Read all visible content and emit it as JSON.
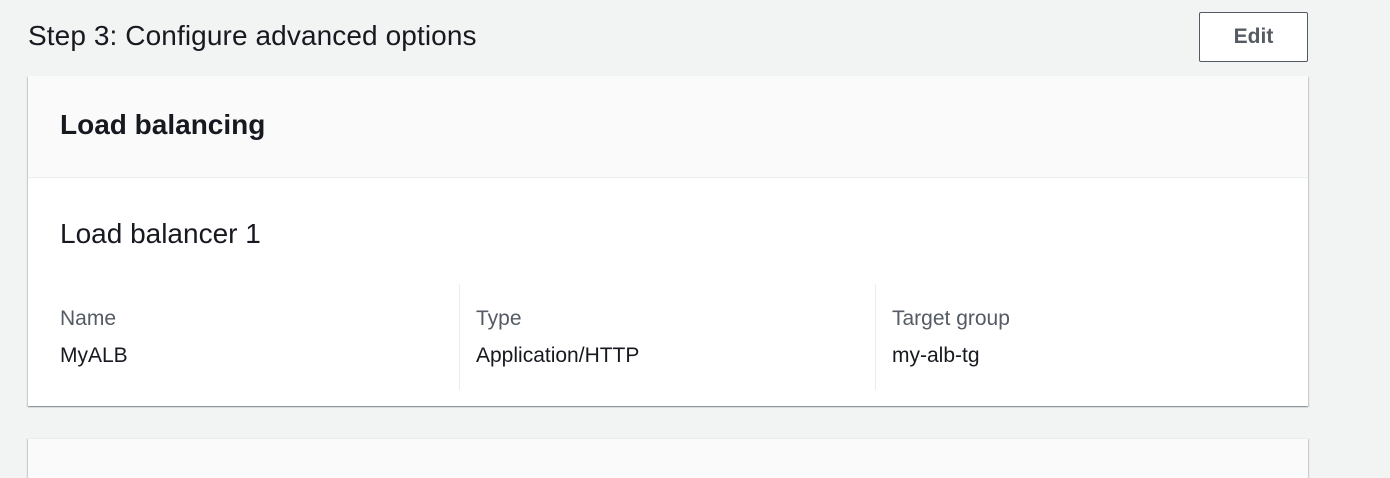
{
  "step": {
    "title": "Step 3: Configure advanced options",
    "edit_label": "Edit"
  },
  "card": {
    "title": "Load balancing",
    "section_title": "Load balancer 1",
    "fields": [
      {
        "label": "Name",
        "value": "MyALB"
      },
      {
        "label": "Type",
        "value": "Application/HTTP"
      },
      {
        "label": "Target group",
        "value": "my-alb-tg"
      }
    ]
  },
  "colors": {
    "background": "#f2f3f3",
    "card_background": "#ffffff",
    "card_header_background": "#fafafa",
    "text_primary": "#16191f",
    "text_secondary": "#545b64",
    "divider": "#eaeded"
  }
}
